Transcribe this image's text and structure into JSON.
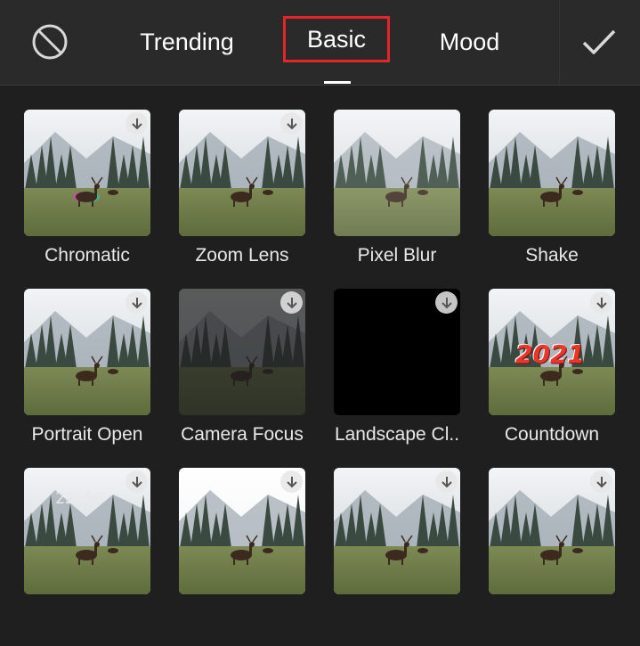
{
  "colors": {
    "background": "#1f1f1f",
    "topbar": "#2a2a2a",
    "highlight_box": "#e0252b",
    "text": "#ffffff"
  },
  "toolbar": {
    "none_icon": "no-effect-icon",
    "confirm_icon": "checkmark-icon",
    "tabs": [
      {
        "label": "Trending",
        "selected": false
      },
      {
        "label": "Basic",
        "selected": true
      },
      {
        "label": "Mood",
        "selected": false
      }
    ]
  },
  "effects": [
    {
      "label": "Chromatic",
      "style": "chromatic",
      "downloadable": true
    },
    {
      "label": "Zoom Lens",
      "style": "zoom",
      "downloadable": true
    },
    {
      "label": "Pixel Blur",
      "style": "blur",
      "downloadable": false
    },
    {
      "label": "Shake",
      "style": "shake",
      "downloadable": false
    },
    {
      "label": "Portrait Open",
      "style": "portrait",
      "downloadable": true
    },
    {
      "label": "Camera Focus",
      "style": "dark",
      "downloadable": true
    },
    {
      "label": "Landscape Cl..",
      "style": "black",
      "downloadable": true
    },
    {
      "label": "Countdown",
      "style": "countdown",
      "downloadable": true,
      "overlay_text": "2021"
    },
    {
      "label": "",
      "style": "clock",
      "downloadable": true,
      "overlay_text": "22:50"
    },
    {
      "label": "",
      "style": "bright",
      "downloadable": true
    },
    {
      "label": "",
      "style": "normal",
      "downloadable": true
    },
    {
      "label": "",
      "style": "normal",
      "downloadable": true
    }
  ]
}
